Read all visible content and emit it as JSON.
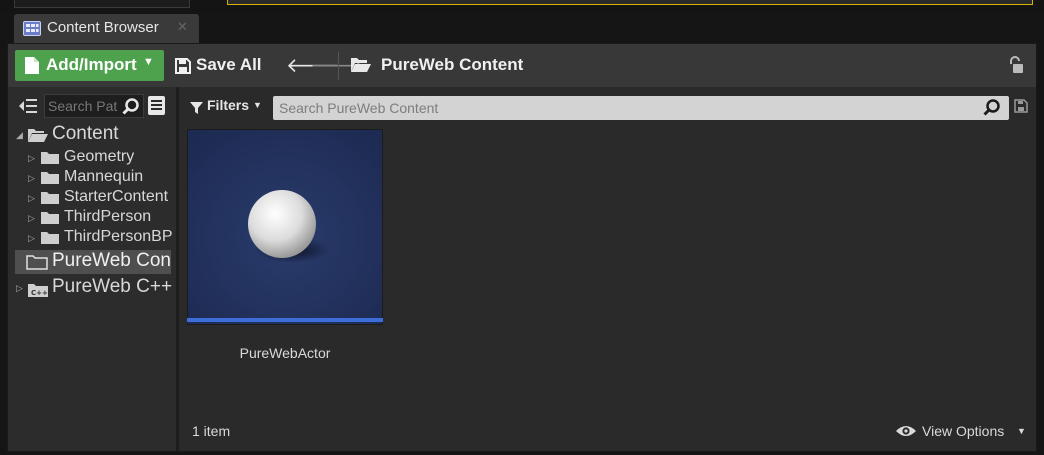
{
  "tab": {
    "title": "Content Browser"
  },
  "toolbar": {
    "add_import_label": "Add/Import",
    "save_all_label": "Save All",
    "current_path": "PureWeb Content"
  },
  "sources": {
    "search_placeholder": "Search Paths",
    "tree": [
      {
        "label": "Content",
        "expanded": true
      },
      {
        "label": "Geometry"
      },
      {
        "label": "Mannequin"
      },
      {
        "label": "StarterContent"
      },
      {
        "label": "ThirdPerson"
      },
      {
        "label": "ThirdPersonBP"
      },
      {
        "label": "PureWeb Content",
        "selected": true
      },
      {
        "label": "PureWeb C++ Classes"
      }
    ]
  },
  "content": {
    "filters_label": "Filters",
    "search_placeholder": "Search PureWeb Content",
    "assets": [
      {
        "name": "PureWebActor",
        "accent_color": "#3d6ed8"
      }
    ],
    "item_count": "1 item",
    "view_options_label": "View Options"
  }
}
